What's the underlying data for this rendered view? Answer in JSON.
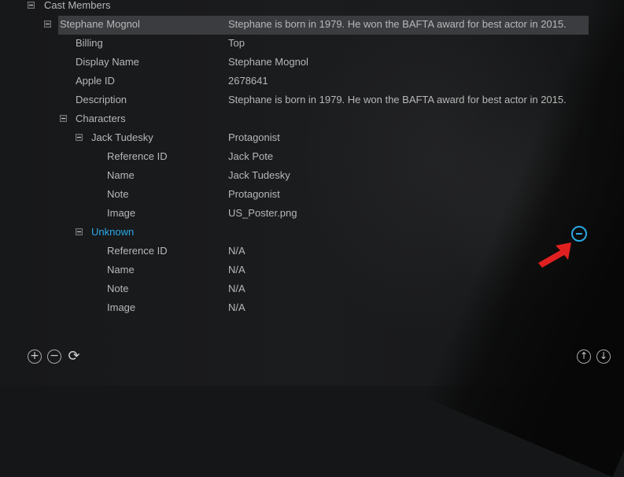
{
  "tree": {
    "root": "Cast Members",
    "cast": {
      "name": "Stephane Mognol",
      "summary": "Stephane is born in 1979. He won the BAFTA award for best actor in 2015.",
      "fields": [
        {
          "key": "Billing",
          "value": "Top"
        },
        {
          "key": "Display Name",
          "value": "Stephane Mognol"
        },
        {
          "key": "Apple ID",
          "value": "2678641"
        },
        {
          "key": "Description",
          "value": "Stephane is born in 1979. He won the BAFTA award for best actor in 2015."
        }
      ],
      "characters_label": "Characters",
      "characters": [
        {
          "name": "Jack Tudesky",
          "summary": "Protagonist",
          "fields": [
            {
              "key": "Reference ID",
              "value": "Jack Pote"
            },
            {
              "key": "Name",
              "value": "Jack Tudesky"
            },
            {
              "key": "Note",
              "value": "Protagonist"
            },
            {
              "key": "Image",
              "value": "US_Poster.png"
            }
          ]
        },
        {
          "name": "Unknown",
          "summary": "",
          "fields": [
            {
              "key": "Reference ID",
              "value": "N/A"
            },
            {
              "key": "Name",
              "value": "N/A"
            },
            {
              "key": "Note",
              "value": "N/A"
            },
            {
              "key": "Image",
              "value": "N/A"
            }
          ]
        }
      ]
    }
  },
  "toolbar": {
    "add_icon": "+",
    "remove_icon": "−",
    "refresh_icon": "⟳",
    "up_icon": "↑",
    "down_icon": "↓"
  },
  "colors": {
    "accent": "#2aa8e6",
    "selection": "#3b3c3f",
    "annotation_arrow": "#e02020"
  }
}
